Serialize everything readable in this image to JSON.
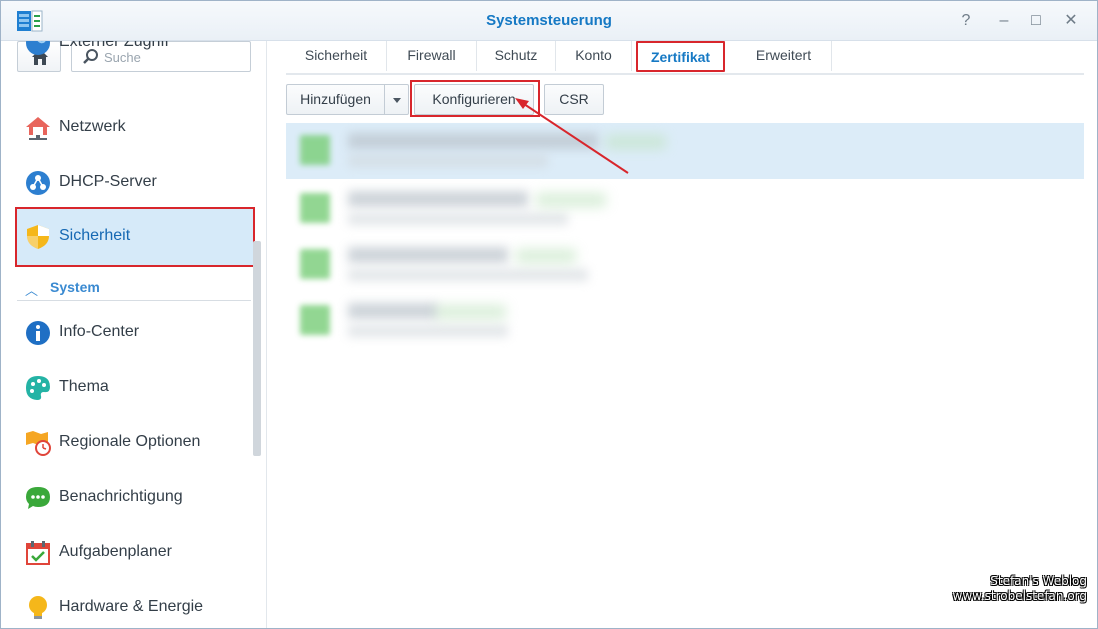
{
  "window": {
    "title": "Systemsteuerung"
  },
  "window_controls": {
    "help": "?",
    "minimize": "–",
    "maximize": "□",
    "close": "✕"
  },
  "search": {
    "placeholder": "Suche",
    "value": ""
  },
  "sidebar": {
    "items": [
      {
        "label": "Externer Zugriff",
        "icon": "globe-icon"
      },
      {
        "label": "Netzwerk",
        "icon": "house-network-icon"
      },
      {
        "label": "DHCP-Server",
        "icon": "dhcp-icon"
      },
      {
        "label": "Sicherheit",
        "icon": "shield-icon",
        "active": true
      }
    ],
    "section": {
      "label": "System",
      "icon": "chevron-up-icon"
    },
    "system_items": [
      {
        "label": "Info-Center",
        "icon": "info-icon"
      },
      {
        "label": "Thema",
        "icon": "palette-icon"
      },
      {
        "label": "Regionale Optionen",
        "icon": "map-clock-icon"
      },
      {
        "label": "Benachrichtigung",
        "icon": "chat-bubble-icon"
      },
      {
        "label": "Aufgabenplaner",
        "icon": "calendar-check-icon"
      },
      {
        "label": "Hardware & Energie",
        "icon": "lightbulb-icon"
      }
    ]
  },
  "tabs": [
    {
      "label": "Sicherheit"
    },
    {
      "label": "Firewall"
    },
    {
      "label": "Schutz"
    },
    {
      "label": "Konto"
    },
    {
      "label": "Zertifikat",
      "active": true
    },
    {
      "label": "Erweitert"
    }
  ],
  "toolbar": {
    "add_label": "Hinzufügen",
    "configure_label": "Konfigurieren",
    "csr_label": "CSR"
  },
  "watermark": {
    "line1": "Stefan's Weblog",
    "line2": "www.strobelstefan.org"
  },
  "colors": {
    "accent": "#1679c4",
    "highlight": "#d8262c",
    "selected_bg": "#d6eaf9"
  }
}
